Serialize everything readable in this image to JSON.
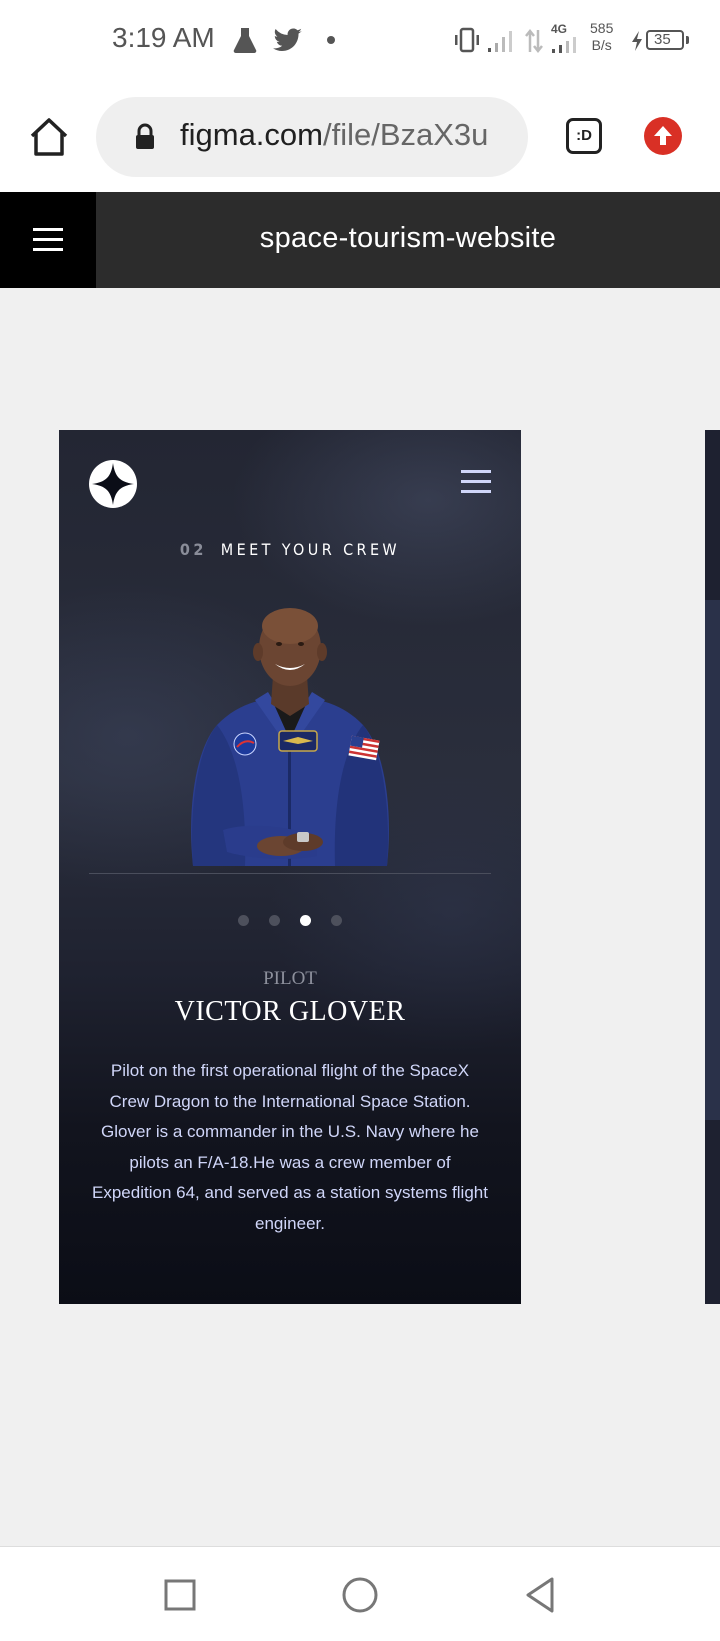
{
  "status_bar": {
    "time": "3:19 AM",
    "net_4g": "4G",
    "net_speed_value": "585",
    "net_speed_unit": "B/s",
    "battery_level": "35",
    "icons": [
      "flask-icon",
      "twitter-icon",
      "dot-icon",
      "vibrate-icon",
      "signal-icon",
      "data-transfer-icon",
      "signal-4g-icon",
      "charging-icon",
      "battery-icon"
    ]
  },
  "browser": {
    "url_host": "figma.com",
    "url_path": "/file/BzaX3u",
    "tabs_label": ":D",
    "icons": [
      "home-icon",
      "lock-icon",
      "tab-switcher-icon",
      "update-icon"
    ]
  },
  "figma": {
    "title": "space-tourism-website",
    "icons": [
      "hamburger-menu-icon"
    ]
  },
  "page": {
    "eyebrow_number": "02",
    "eyebrow_text": "MEET YOUR CREW",
    "carousel": {
      "total": 4,
      "active_index": 2
    },
    "role": "PILOT",
    "name": "VICTOR GLOVER",
    "bio": "Pilot on the first operational flight of the SpaceX Crew Dragon to the International Space Station. Glover is a commander in the U.S. Navy where he pilots an F/A-18.He was a crew member of Expedition 64, and served as a station systems flight engineer.",
    "icons": [
      "star-logo-icon",
      "menu-icon"
    ]
  },
  "colors": {
    "figma_bar": "#2c2c2c",
    "update_button": "#d93025",
    "frame_text_light": "#d0d6f9"
  },
  "nav": {
    "icons": [
      "recent-apps-icon",
      "home-circle-icon",
      "back-icon"
    ]
  }
}
